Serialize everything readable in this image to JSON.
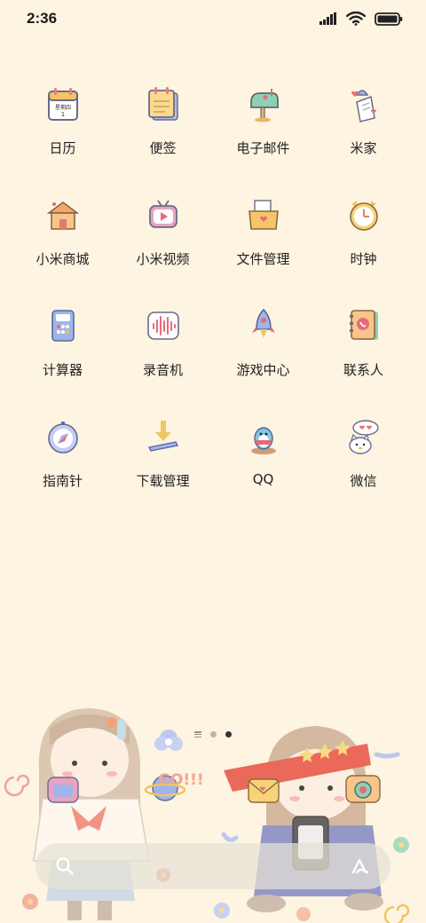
{
  "status_bar": {
    "time": "2:36"
  },
  "apps": [
    {
      "label": "日历",
      "icon": "calendar-icon",
      "badge": "星期四",
      "day": "1"
    },
    {
      "label": "便签",
      "icon": "notes-icon"
    },
    {
      "label": "电子邮件",
      "icon": "email-icon"
    },
    {
      "label": "米家",
      "icon": "mijia-icon"
    },
    {
      "label": "小米商城",
      "icon": "mi-store-icon"
    },
    {
      "label": "小米视频",
      "icon": "mi-video-icon"
    },
    {
      "label": "文件管理",
      "icon": "file-manager-icon"
    },
    {
      "label": "时钟",
      "icon": "clock-icon"
    },
    {
      "label": "计算器",
      "icon": "calculator-icon"
    },
    {
      "label": "录音机",
      "icon": "recorder-icon"
    },
    {
      "label": "游戏中心",
      "icon": "game-center-icon"
    },
    {
      "label": "联系人",
      "icon": "contacts-icon"
    },
    {
      "label": "指南针",
      "icon": "compass-icon"
    },
    {
      "label": "下载管理",
      "icon": "downloads-icon"
    },
    {
      "label": "QQ",
      "icon": "qq-icon"
    },
    {
      "label": "微信",
      "icon": "wechat-icon"
    }
  ],
  "page_indicator": {
    "pages": 2,
    "active": 2
  },
  "wallpaper_text": "GO!!!",
  "search_bar": {
    "left_icon": "search-icon",
    "right_icon": "assistant-icon"
  }
}
